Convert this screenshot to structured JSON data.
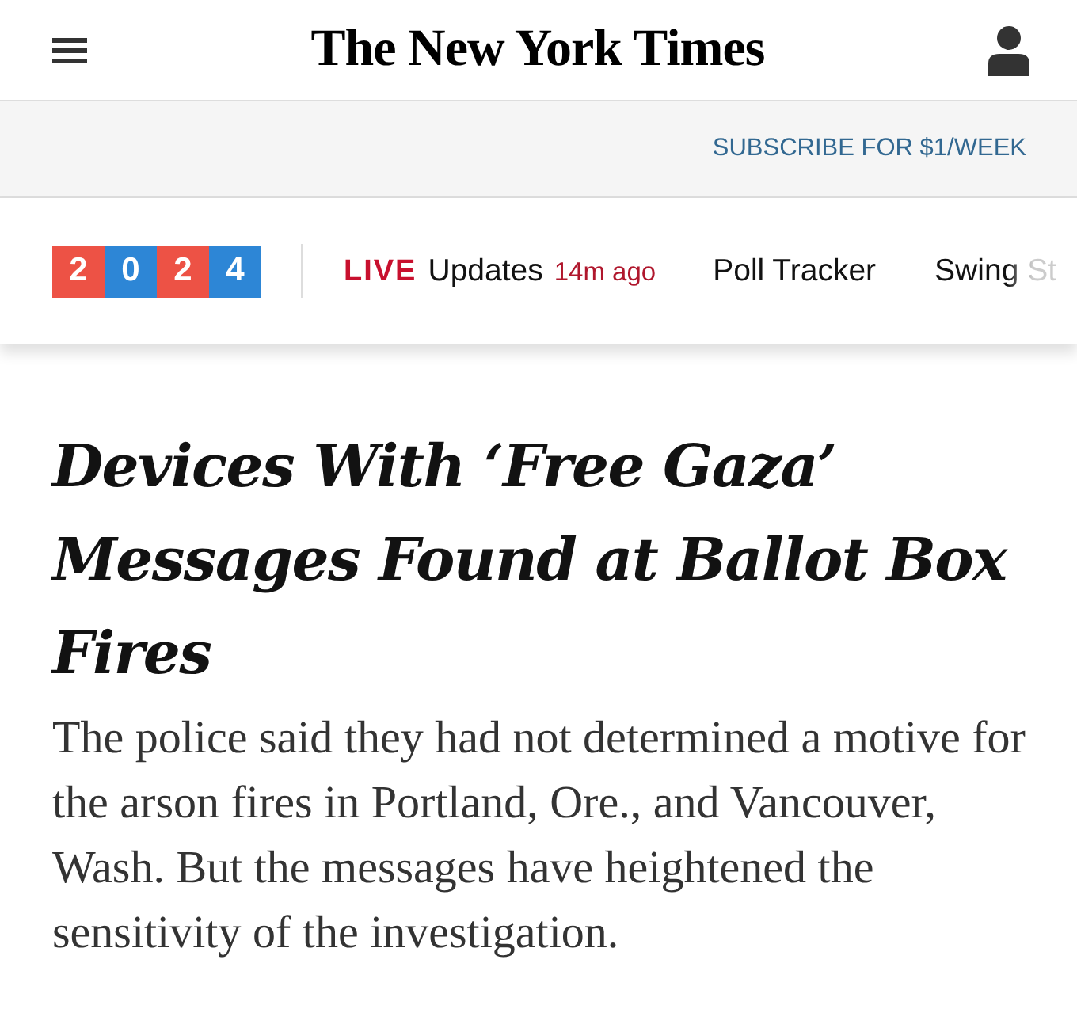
{
  "masthead": {
    "logo": "The New York Times"
  },
  "subscribe_bar": {
    "link": "SUBSCRIBE FOR $1/WEEK"
  },
  "nav": {
    "year_badge": [
      {
        "digit": "2",
        "color": "#ed5245"
      },
      {
        "digit": "0",
        "color": "#2d86d6"
      },
      {
        "digit": "2",
        "color": "#ed5245"
      },
      {
        "digit": "4",
        "color": "#2d86d6"
      }
    ],
    "live_label": "LIVE",
    "live_link": "Updates",
    "live_time": "14m ago",
    "items": [
      "Poll Tracker",
      "Swing St"
    ]
  },
  "article": {
    "headline": "Devices With ‘Free Gaza’ Messages Found at Ballot Box Fires",
    "summary": "The police said they had not determined a motive for the arson fires in Portland, Ore., and Vancouver, Wash. But the messages have heightened the sensitivity of the investigation."
  }
}
